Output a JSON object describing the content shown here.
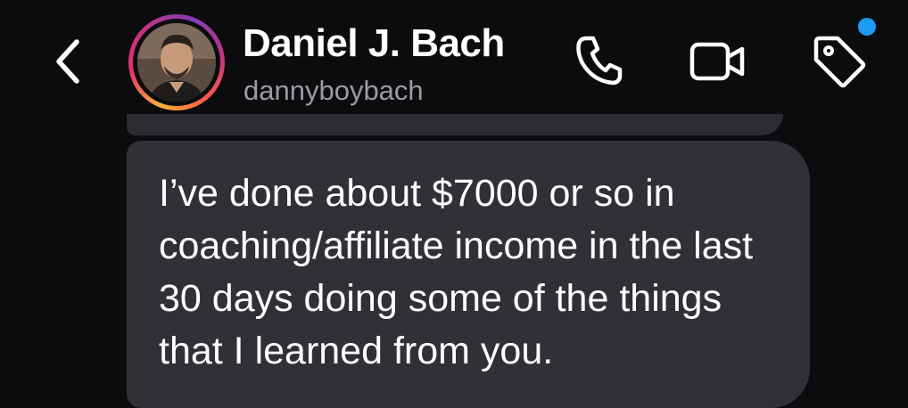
{
  "header": {
    "name": "Daniel J. Bach",
    "username": "dannyboybach",
    "icons": {
      "back": "chevron-left-icon",
      "call": "phone-icon",
      "video": "video-camera-icon",
      "tag": "tag-icon"
    },
    "notification_dot_color": "#1d9bf0"
  },
  "message": {
    "text": "I’ve done about $7000 or so in coaching/affiliate income in the last 30 days doing some of the things that I learned from you."
  },
  "colors": {
    "background": "#0b0c0e",
    "bubble": "#2f3136",
    "text_primary": "#ffffff",
    "text_secondary": "#9a9ca1"
  }
}
